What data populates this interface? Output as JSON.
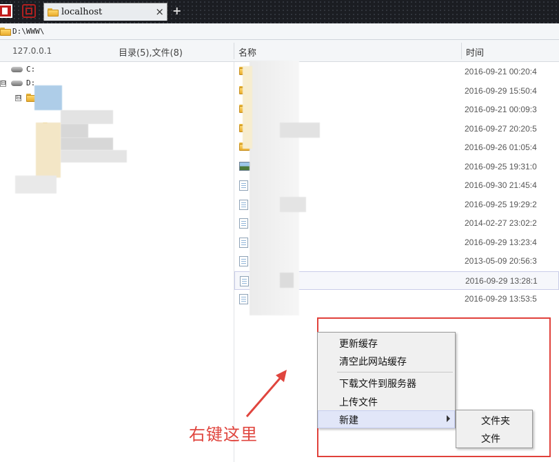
{
  "tab": {
    "title": "localhost",
    "close_glyph": "×",
    "new_glyph": "+"
  },
  "address": {
    "path": "D:\\WWW\\"
  },
  "header": {
    "host": "127.0.0.1",
    "summary": "目录(5),文件(8)",
    "col_name": "名称",
    "col_time": "时间"
  },
  "tree": {
    "drives": [
      {
        "label": "C:",
        "expander": ""
      },
      {
        "label": "D:",
        "expander": "⊟"
      }
    ],
    "sub_expander": "⊟"
  },
  "files": [
    {
      "icon": "folder-icon",
      "time": "2016-09-21 00:20:4"
    },
    {
      "icon": "folder-icon",
      "time": "2016-09-29 15:50:4"
    },
    {
      "icon": "folder-icon",
      "time": "2016-09-21 00:09:3"
    },
    {
      "icon": "folder-icon",
      "time": "2016-09-27 20:20:5"
    },
    {
      "icon": "folder-icon",
      "time": "2016-09-26 01:05:4"
    },
    {
      "icon": "image-file-icon",
      "time": "2016-09-25 19:31:0"
    },
    {
      "icon": "document-icon",
      "time": "2016-09-30 21:45:4"
    },
    {
      "icon": "document-icon",
      "time": "2016-09-25 19:29:2"
    },
    {
      "icon": "document-icon",
      "time": "2014-02-27 23:02:2"
    },
    {
      "icon": "document-icon",
      "time": "2016-09-29 13:23:4"
    },
    {
      "icon": "document-icon",
      "time": "2013-05-09 20:56:3"
    },
    {
      "icon": "document-icon",
      "time": "2016-09-29 13:28:1"
    },
    {
      "icon": "document-icon",
      "time": "2016-09-29 13:53:5"
    }
  ],
  "context_menu": {
    "refresh_cache": "更新缓存",
    "clear_site_cache": "清空此网站缓存",
    "download_to_server": "下载文件到服务器",
    "upload_file": "上传文件",
    "new": "新建"
  },
  "submenu": {
    "folder": "文件夹",
    "file": "文件"
  },
  "annotation": {
    "text": "右键这里",
    "color": "#e0453e"
  }
}
